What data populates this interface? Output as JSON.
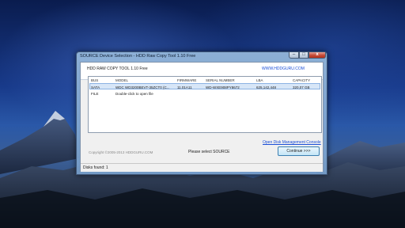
{
  "window": {
    "title": "SOURCE Device Selection - HDD Raw Copy Tool 1.10    Free",
    "min_glyph": "–",
    "max_glyph": "□",
    "close_glyph": "x"
  },
  "header": {
    "app_title": "HDD RAW COPY TOOL 1.10    Free",
    "website": "WWW.HDDGURU.COM"
  },
  "device_list": {
    "columns": [
      "BUS",
      "MODEL",
      "FIRMWARE",
      "SERIAL NUMBER",
      "LBA",
      "CAPACITY"
    ],
    "rows": [
      {
        "bus": "SATA",
        "model": "WDC WD3200BEVT-35ZCT0 (C...",
        "firmware": "11.01A11",
        "serial": "WD-WXE908PY8672",
        "lba": "625,142,448",
        "capacity": "320,07 GB",
        "selected": true
      },
      {
        "bus": "FILE",
        "model": "Double-click to open file",
        "firmware": "",
        "serial": "",
        "lba": "",
        "capacity": "",
        "selected": false
      }
    ]
  },
  "footer": {
    "open_disk_link": "Open Disk Management Console",
    "copyright": "Copyright ©2005-2013 HDDGURU.COM",
    "status_message": "Please select SOURCE",
    "continue_label": "Continue >>>"
  },
  "statusbar": {
    "text": "Disks found: 1"
  }
}
